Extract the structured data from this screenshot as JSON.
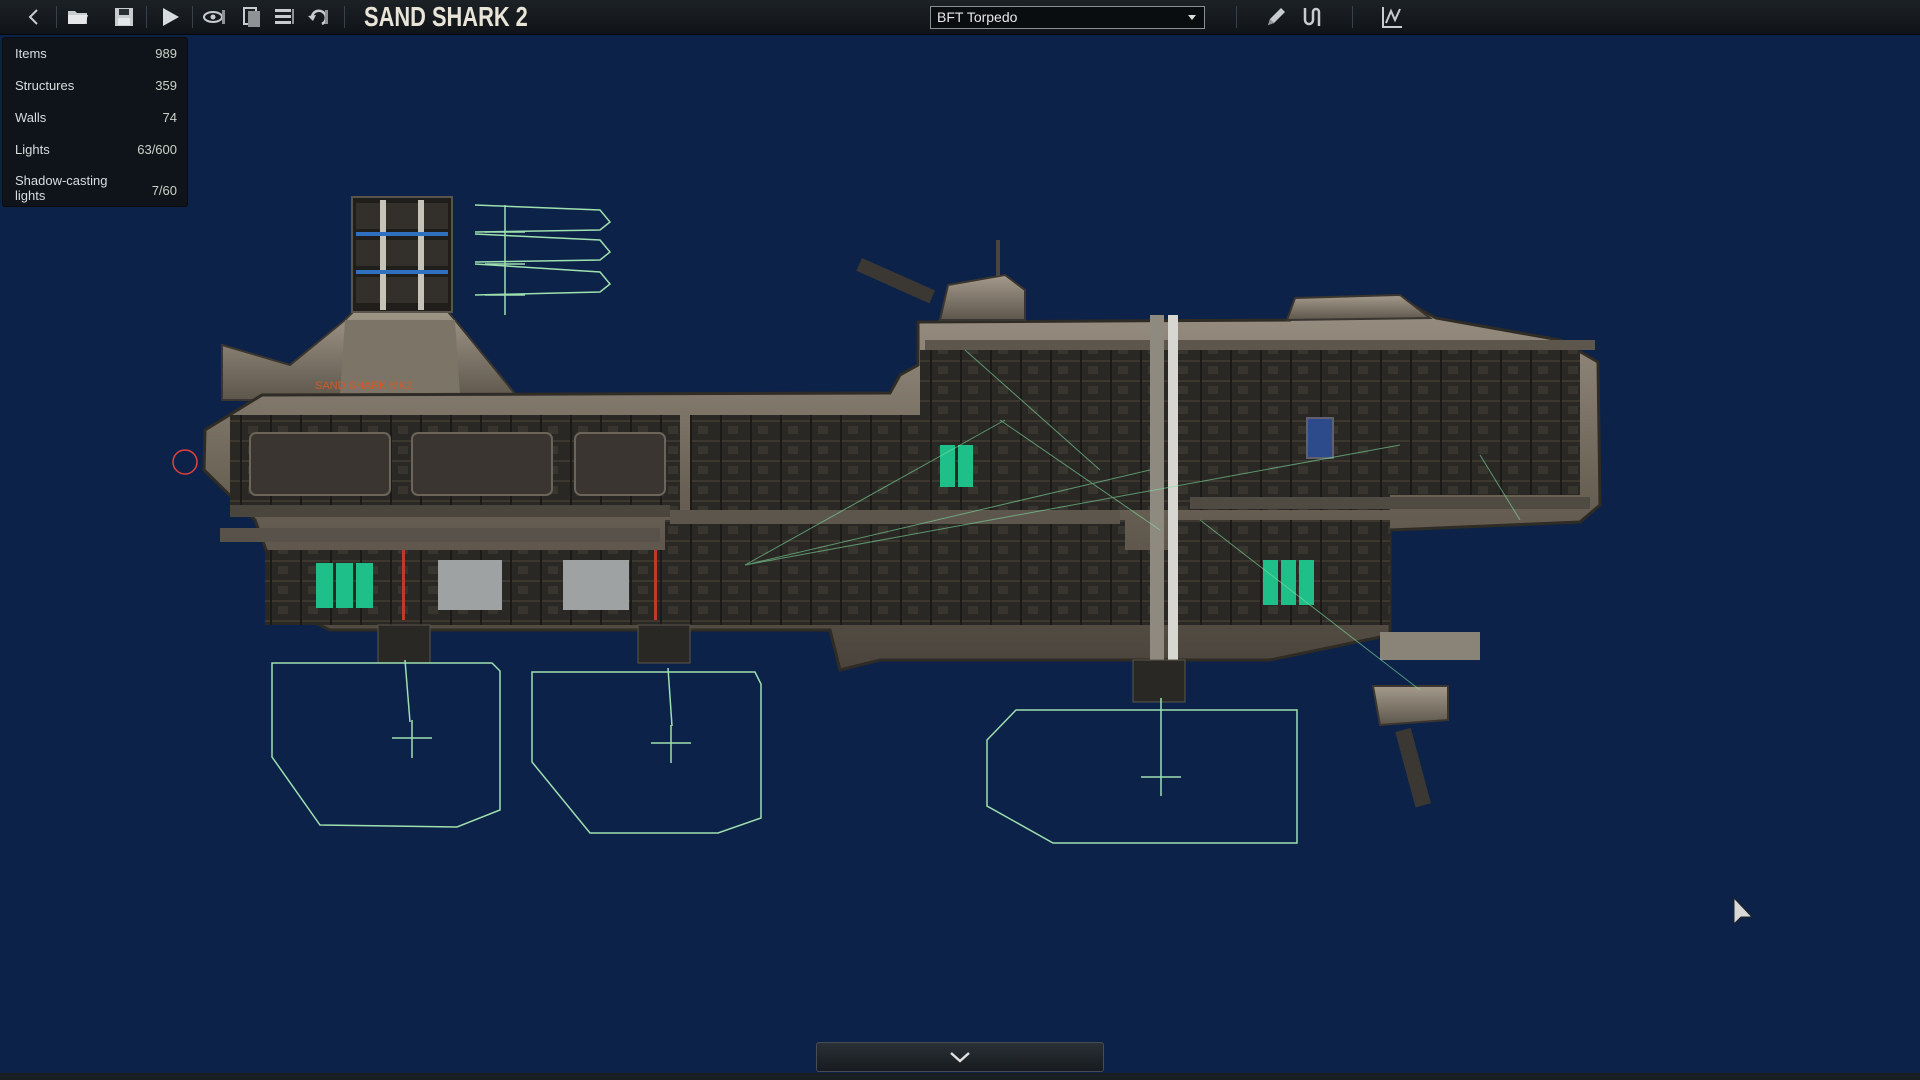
{
  "toolbar": {
    "title": "SAND SHARK 2",
    "selected_item": "BFT Torpedo",
    "buttons": [
      {
        "icon": "back-arrow-icon"
      },
      {
        "icon": "open-folder-icon"
      },
      {
        "icon": "save-icon"
      },
      {
        "icon": "play-icon"
      },
      {
        "icon": "visibility-icon"
      },
      {
        "icon": "layers-icon"
      },
      {
        "icon": "list-icon"
      },
      {
        "icon": "undo-icon"
      },
      {
        "icon": "pencil-icon"
      },
      {
        "icon": "wire-icon"
      },
      {
        "icon": "graph-icon"
      }
    ]
  },
  "stats": {
    "items_label": "Items",
    "items_value": "989",
    "structures_label": "Structures",
    "structures_value": "359",
    "walls_label": "Walls",
    "walls_value": "74",
    "lights_label": "Lights",
    "lights_value": "63/600",
    "shadow_label": "Shadow-casting lights",
    "shadow_value": "7/60"
  },
  "hull_text": "SAND SHARK MK2",
  "colors": {
    "background": "#0c2248",
    "outline": "#9ee0b0",
    "hull": "#6e6558",
    "accent": "#d05a2a",
    "teal": "#1fbf8a"
  }
}
